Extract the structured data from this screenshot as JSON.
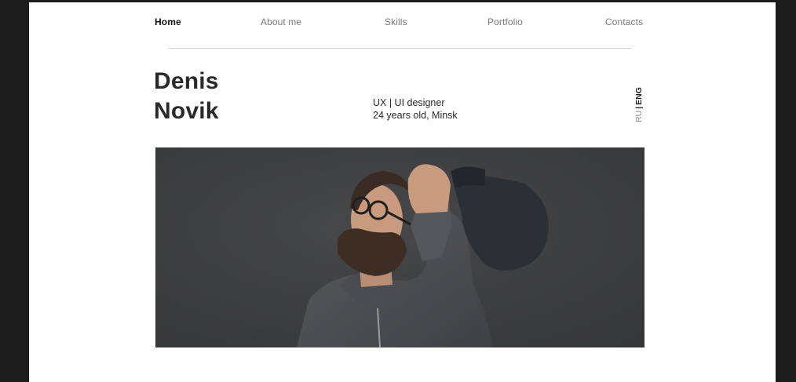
{
  "nav": {
    "items": [
      {
        "label": "Home",
        "active": true
      },
      {
        "label": "About me",
        "active": false
      },
      {
        "label": "Skills",
        "active": false
      },
      {
        "label": "Portfolio",
        "active": false
      },
      {
        "label": "Contacts",
        "active": false
      }
    ]
  },
  "hero": {
    "first_name": "Denis",
    "last_name": "Novik",
    "role": "UX | UI designer",
    "details": "24 years old, Minsk"
  },
  "language": {
    "ru": "RU",
    "separator": "|",
    "eng": "ENG",
    "selected": "ENG"
  },
  "colors": {
    "background": "#1c1c1c",
    "page": "#ffffff",
    "text_dark": "#2a2a2a",
    "nav_inactive": "#7a7a7a",
    "photo_bg": "#3d3e40"
  }
}
